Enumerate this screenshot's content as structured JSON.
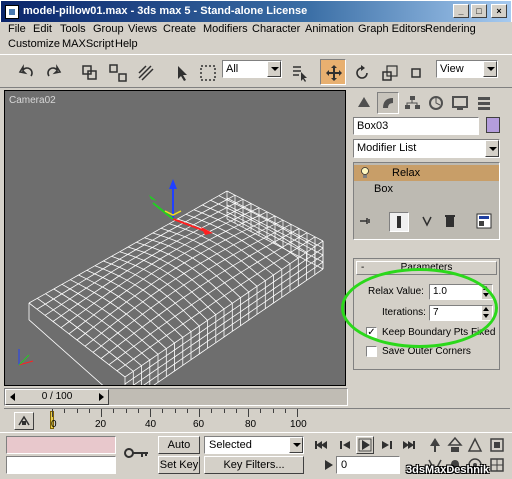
{
  "window": {
    "title": "model-pillow01.max - 3ds max 5 - Stand-alone License",
    "minimize_icon": "minimize-icon",
    "maximize_icon": "maximize-icon",
    "close_icon": "close-icon"
  },
  "menu": {
    "row1": [
      "File",
      "Edit",
      "Tools",
      "Group",
      "Views",
      "Create",
      "Modifiers",
      "Character",
      "Animation",
      "Graph Editors",
      "Rendering"
    ],
    "row2": [
      "Customize",
      "MAXScript",
      "Help"
    ]
  },
  "toolbar": {
    "selection_filter": "All",
    "reference_coord": "View"
  },
  "viewport": {
    "label": "Camera02",
    "wireframe_color": "#ffffff",
    "background_color": "#6e6e6e"
  },
  "command_panel": {
    "object_name": "Box03",
    "object_color": "#b49ddc",
    "modifier_list": "Modifier List",
    "stack": [
      {
        "label": "Relax",
        "selected": true
      },
      {
        "label": "Box",
        "selected": false
      }
    ],
    "rollout_title": "Parameters",
    "rollout_collapse": "-",
    "relax_value_label": "Relax Value:",
    "relax_value": "1.0",
    "iterations_label": "Iterations:",
    "iterations": "7",
    "keep_boundary_label": "Keep Boundary Pts Fixed",
    "keep_boundary_checked": true,
    "save_outer_label": "Save Outer Corners",
    "save_outer_checked": false,
    "highlight_color": "#2bd81b"
  },
  "timeline": {
    "slider_label": "0 / 100",
    "ticks": [
      "0",
      "20",
      "40",
      "60",
      "80",
      "100"
    ]
  },
  "status": {
    "auto_key": "Auto Key",
    "set_key": "Set Key",
    "selected_combo": "Selected",
    "key_filters": "Key Filters...",
    "current_frame": "0",
    "watermark": "3dsMaxDeshnik"
  }
}
